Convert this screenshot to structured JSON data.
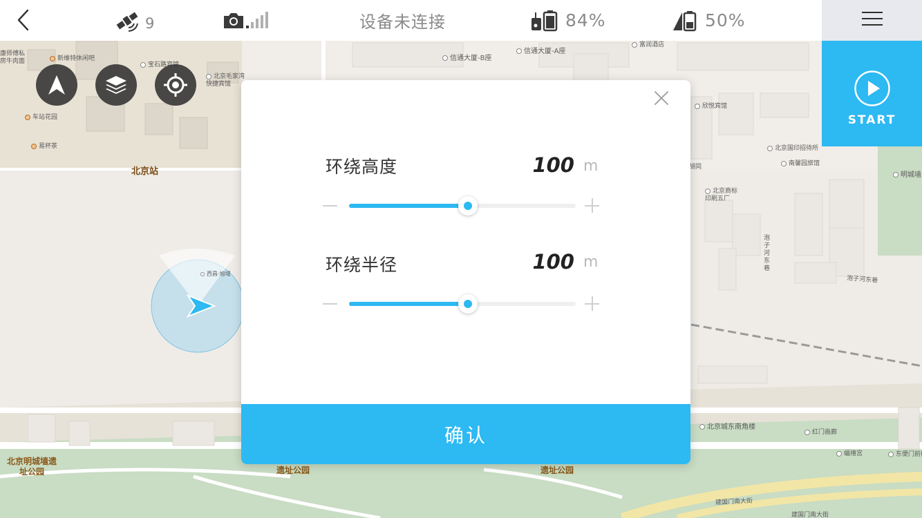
{
  "topbar": {
    "gps_count": "9",
    "connection_status": "设备未连接",
    "rc_battery": "84%",
    "drone_battery": "50%"
  },
  "start": {
    "label": "START"
  },
  "map": {
    "labels": {
      "beijing_station": "北京站",
      "xintong_b": "信通大厦-B座",
      "xintong_a": "信通大厦-A座",
      "furun_hotel": "富润酒店",
      "xinyue_hotel": "欣悦宾馆",
      "guoyin_factory": "北京国印招待所",
      "nanxin_hotel": "南馨园旅馆",
      "shangbiao": "北京商标印刷五厂",
      "paozi_hedong_v": "泡子河东巷",
      "paozi_hedong": "泡子河东巷",
      "mingcheng_right": "明城墙",
      "dongnan_jiaolou": "北京城东南角楼",
      "honggen_miao": "红门画廊",
      "fuxiu_gong": "蝠禧宫",
      "dongbian_men": "东便门前街",
      "jianguomen_nan": "建国门南大街",
      "jianguomen_nan2": "建国门南大街",
      "ming_wall_park_left": "北京明城墙遗址公园",
      "ming_wall_park_mid": "遗址公园",
      "ming_wall_park_mid2": "遗址公园",
      "xintequ": "新维特休闲吧",
      "baoshilu": "宝石路宾馆",
      "maojia": "北京毛家湾快捷宾馆",
      "chezhan_huayuan": "车站花园",
      "yibeicha": "易杯茶",
      "kangshi": "康师傅私房牛肉面",
      "xichang": "西昌·旭域",
      "hutong": "胡同"
    }
  },
  "modal": {
    "height_label": "环绕高度",
    "height_value": "100",
    "height_unit": "m",
    "height_slider": 0.525,
    "radius_label": "环绕半径",
    "radius_value": "100",
    "radius_unit": "m",
    "radius_slider": 0.525,
    "confirm_label": "确认"
  },
  "colors": {
    "accent": "#2db9f2",
    "menu_panel": "#e7e9ee",
    "map_button": "#3a3a3a"
  },
  "icons": [
    "back-arrow-icon",
    "satellite-icon",
    "camera-signal-icon",
    "rc-battery-icon",
    "drone-battery-icon",
    "menu-icon",
    "play-icon",
    "navigation-arrow-icon",
    "layers-icon",
    "crosshair-icon",
    "close-icon",
    "minus-icon",
    "plus-icon",
    "aircraft-marker-icon"
  ]
}
